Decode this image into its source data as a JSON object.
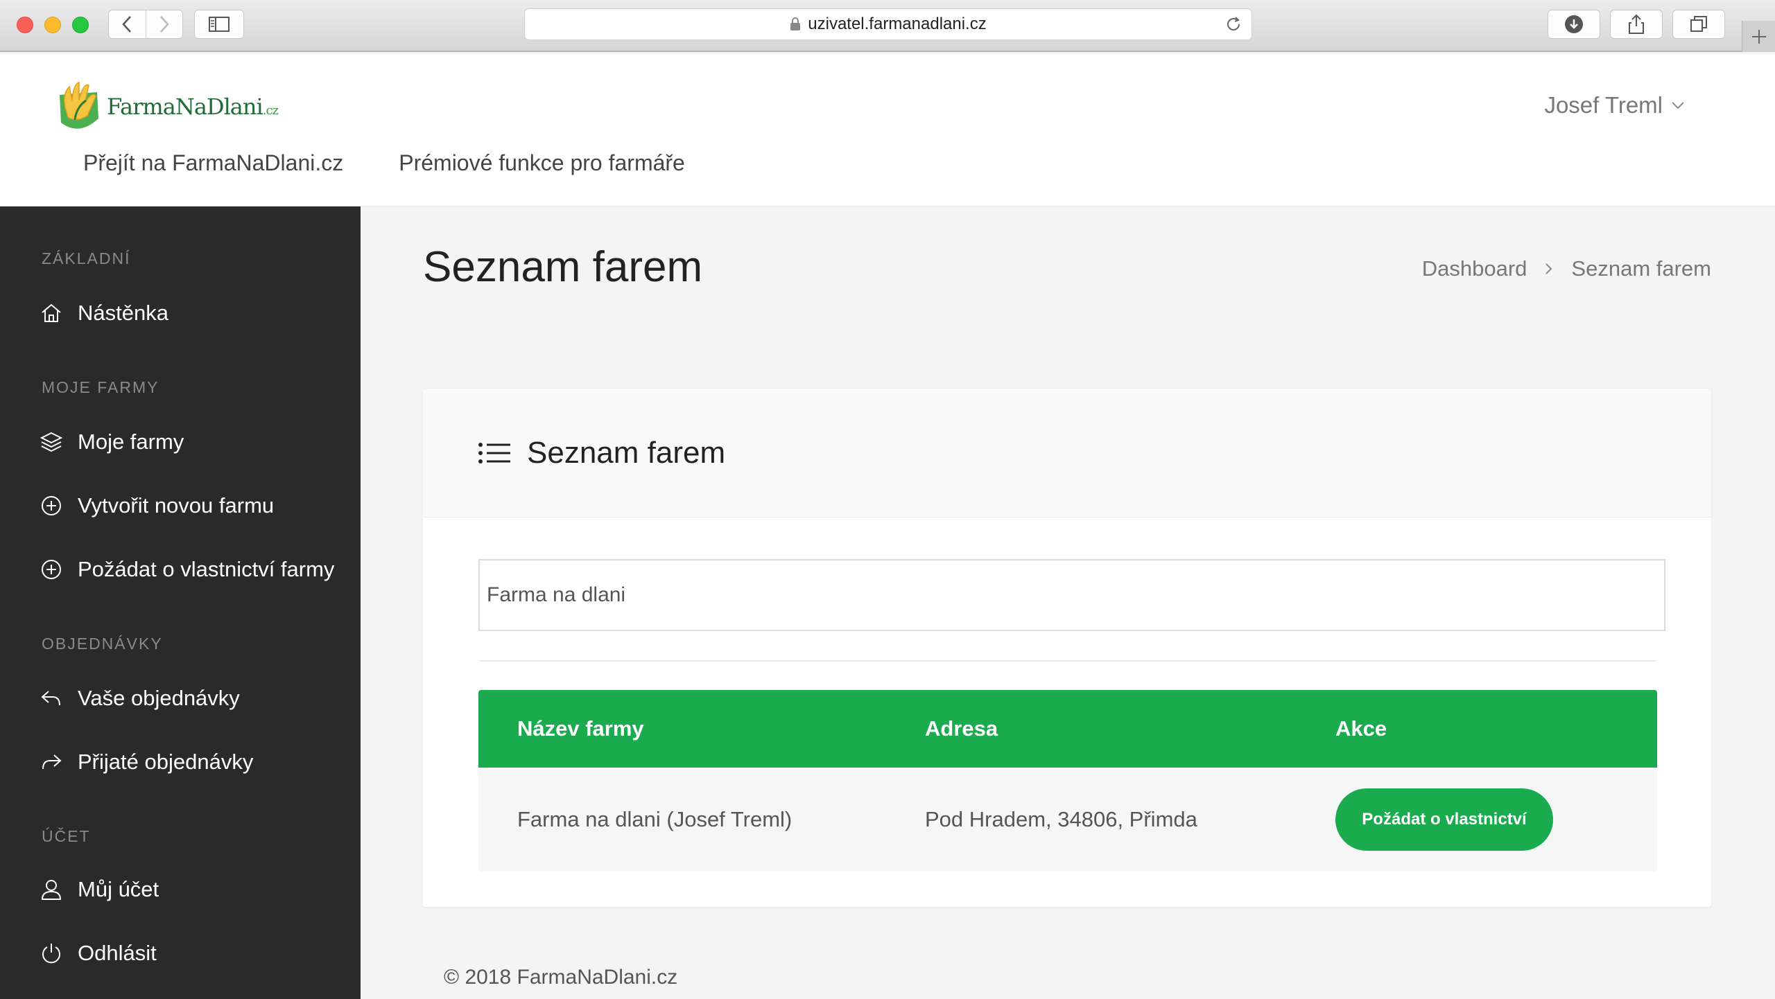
{
  "browser": {
    "url": "uzivatel.farmanadlani.cz"
  },
  "header": {
    "logo_text": "FarmaNaDlani",
    "logo_tld": ".cz",
    "user_name": "Josef Treml",
    "nav": [
      {
        "label": "Přejít na FarmaNaDlani.cz"
      },
      {
        "label": "Prémiové funkce pro farmáře"
      }
    ]
  },
  "sidebar": {
    "sections": [
      {
        "label": "ZÁKLADNÍ"
      },
      {
        "label": "MOJE FARMY"
      },
      {
        "label": "OBJEDNÁVKY"
      },
      {
        "label": "ÚČET"
      }
    ],
    "items": [
      {
        "label": "Nástěnka",
        "icon": "home-icon"
      },
      {
        "label": "Moje farmy",
        "icon": "layers-icon"
      },
      {
        "label": "Vytvořit novou farmu",
        "icon": "plus-circle-icon"
      },
      {
        "label": "Požádat o vlastnictví farmy",
        "icon": "plus-circle-icon"
      },
      {
        "label": "Vaše objednávky",
        "icon": "reply-icon"
      },
      {
        "label": "Přijaté objednávky",
        "icon": "forward-icon"
      },
      {
        "label": "Můj účet",
        "icon": "user-icon"
      },
      {
        "label": "Odhlásit",
        "icon": "power-icon"
      }
    ]
  },
  "main": {
    "title": "Seznam farem",
    "breadcrumb": [
      "Dashboard",
      "Seznam farem"
    ],
    "card": {
      "title": "Seznam farem",
      "search_value": "Farma na dlani",
      "table": {
        "columns": [
          "Název farmy",
          "Adresa",
          "Akce"
        ],
        "rows": [
          {
            "name": "Farma na dlani (Josef Treml)",
            "address": "Pod Hradem, 34806, Přimda",
            "action": "Požádat o vlastnictví"
          }
        ]
      }
    },
    "footer": "© 2018 FarmaNaDlani.cz"
  },
  "colors": {
    "accent": "#1aab4f",
    "sidebar_bg": "#2a2a2a"
  }
}
